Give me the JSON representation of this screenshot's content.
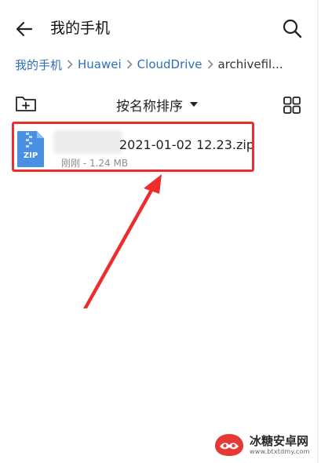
{
  "header": {
    "title": "我的手机",
    "back_icon": "arrow-left-icon",
    "search_icon": "search-icon"
  },
  "breadcrumb": {
    "items": [
      "我的手机",
      "Huawei",
      "CloudDrive",
      "archivefil..."
    ]
  },
  "toolbar": {
    "sort_label": "按名称排序",
    "new_folder_icon": "new-folder-icon",
    "view_icon": "grid-view-icon"
  },
  "files": [
    {
      "name": "2021-01-02 12.23.zip",
      "meta": "刚刚 - 1.24 MB",
      "icon_label": "ZIP"
    }
  ],
  "watermark": {
    "name": "冰糖安卓网",
    "url": "www.btxtdmy.com"
  },
  "colors": {
    "accent": "#2f6fb7",
    "zip_icon": "#4a90e2",
    "highlight": "#ee2c2c"
  }
}
